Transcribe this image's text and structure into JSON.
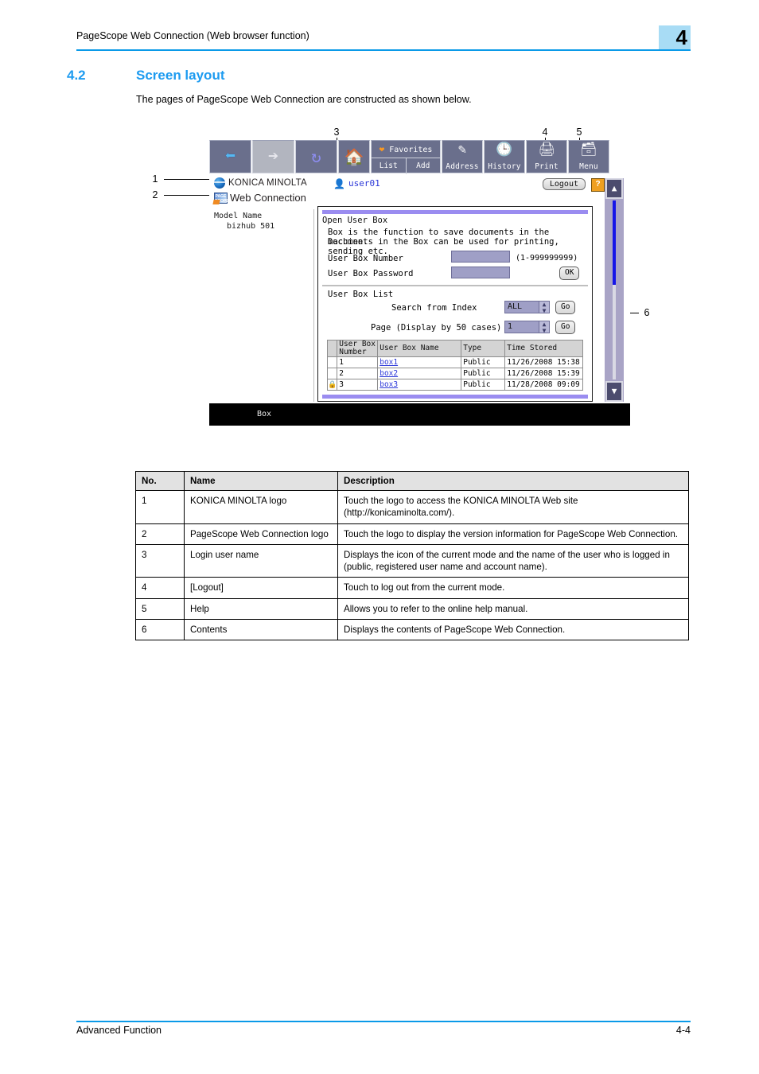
{
  "header": {
    "running_head": "PageScope Web Connection (Web browser function)",
    "chapter_tab": "4"
  },
  "section": {
    "number": "4.2",
    "title": "Screen layout",
    "intro": "The pages of PageScope Web Connection are constructed as shown below."
  },
  "callouts": {
    "one": "1",
    "two": "2",
    "three": "3",
    "four": "4",
    "five": "5",
    "six": "6"
  },
  "screenshot": {
    "toolbar": {
      "back_icon": "back-arrow-icon",
      "forward_icon": "forward-arrow-icon",
      "reload_icon": "reload-icon",
      "home_icon": "home-icon",
      "favorites_label": "Favorites",
      "favorites_list": "List",
      "favorites_add": "Add",
      "address_label": "Address",
      "history_label": "History",
      "print_label": "Print",
      "menu_label": "Menu"
    },
    "brand": {
      "konica_minolta": "KONICA MINOLTA",
      "pagescope_mark": "PAGE SCOPE",
      "web_connection": "Web Connection"
    },
    "user": {
      "name": "user01",
      "logout": "Logout",
      "help": "?"
    },
    "left_pane": {
      "model_label": "Model Name",
      "model_value": "bizhub 501"
    },
    "content": {
      "title": "Open User Box",
      "desc_line1": "Box is the function to save documents in the machine.",
      "desc_line2": "Documents in the Box can be used for printing, sending etc.",
      "user_box_number_label": "User Box Number",
      "user_box_number_value": "",
      "user_box_number_range": "(1-999999999)",
      "user_box_password_label": "User Box Password",
      "user_box_password_value": "",
      "ok_button": "OK",
      "list_title": "User Box List",
      "search_index_label": "Search from Index",
      "search_index_value": "ALL",
      "search_index_go": "Go",
      "page_label": "Page (Display by 50 cases)",
      "page_value": "1",
      "page_go": "Go",
      "table": {
        "headers": [
          "",
          "User Box\nNumber",
          "User Box Name",
          "Type",
          "Time Stored"
        ],
        "header_lock": "",
        "header_number": "User Box Number",
        "header_name": "User Box Name",
        "header_type": "Type",
        "header_time": "Time Stored",
        "rows": [
          {
            "lock": "",
            "number": "1",
            "name": "box1",
            "type": "Public",
            "time": "11/26/2008 15:38"
          },
          {
            "lock": "",
            "number": "2",
            "name": "box2",
            "type": "Public",
            "time": "11/26/2008 15:39"
          },
          {
            "lock": "locked",
            "number": "3",
            "name": "box3",
            "type": "Public",
            "time": "11/28/2008 09:09"
          }
        ]
      }
    },
    "status_bar": "Box"
  },
  "desc_table": {
    "headers": {
      "no": "No.",
      "name": "Name",
      "description": "Description"
    },
    "rows": [
      {
        "no": "1",
        "name": "KONICA MINOLTA logo",
        "description": "Touch the logo to access the KONICA MINOLTA Web site (http://konicaminolta.com/)."
      },
      {
        "no": "2",
        "name": "PageScope Web Connection logo",
        "description": "Touch the logo to display the version information for PageScope Web Connection."
      },
      {
        "no": "3",
        "name": "Login user name",
        "description": "Displays the icon of the current mode and the name of the user who is logged in (public, registered user name and account name)."
      },
      {
        "no": "4",
        "name": "[Logout]",
        "description": "Touch to log out from the current mode."
      },
      {
        "no": "5",
        "name": "Help",
        "description": "Allows you to refer to the online help manual."
      },
      {
        "no": "6",
        "name": "Contents",
        "description": "Displays the contents of PageScope Web Connection."
      }
    ]
  },
  "footer": {
    "left": "Advanced Function",
    "right": "4-4"
  }
}
